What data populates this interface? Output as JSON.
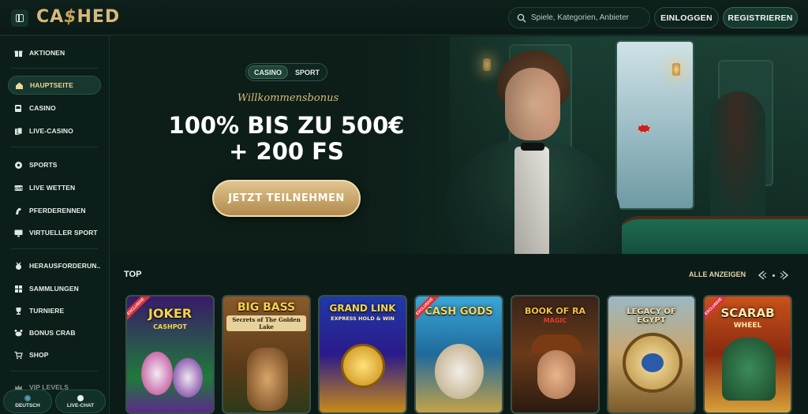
{
  "header": {
    "logo_text": "CASHED",
    "search_placeholder": "Spiele, Kategorien, Anbieter",
    "login_label": "EINLOGGEN",
    "register_label": "REGISTRIEREN"
  },
  "sidebar": {
    "items": [
      {
        "label": "AKTIONEN",
        "icon": "gift-icon"
      },
      {
        "label": "HAUPTSEITE",
        "icon": "home-icon"
      },
      {
        "label": "CASINO",
        "icon": "slot-icon"
      },
      {
        "label": "LIVE-CASINO",
        "icon": "cards-icon"
      },
      {
        "label": "SPORTS",
        "icon": "soccer-icon"
      },
      {
        "label": "LIVE WETTEN",
        "icon": "live-icon"
      },
      {
        "label": "PFERDERENNEN",
        "icon": "horse-icon"
      },
      {
        "label": "VIRTUELLER SPORT",
        "icon": "monitor-icon"
      },
      {
        "label": "HERAUSFORDERUN...",
        "icon": "medal-icon"
      },
      {
        "label": "SAMMLUNGEN",
        "icon": "collection-icon"
      },
      {
        "label": "TURNIERE",
        "icon": "trophy-icon"
      },
      {
        "label": "BONUS CRAB",
        "icon": "crab-icon"
      },
      {
        "label": "SHOP",
        "icon": "cart-icon"
      },
      {
        "label": "VIP LEVELS",
        "icon": "crown-icon"
      }
    ],
    "language_label": "DEUTSCH",
    "chat_label": "LIVE-CHAT"
  },
  "hero": {
    "tab_casino": "CASINO",
    "tab_sport": "SPORT",
    "welcome": "Willkommensbonus",
    "headline_line1": "100% BIS ZU 500€",
    "headline_line2": "+ 200 FS",
    "cta_label": "JETZT TEILNEHMEN"
  },
  "top": {
    "title": "TOP",
    "show_all": "ALLE ANZEIGEN",
    "games": [
      {
        "title": "JOKER",
        "subtitle": "CASHPOT",
        "badge": "EXCLUSIVE"
      },
      {
        "title": "BIG BASS",
        "subtitle": "Secrets of The Golden Lake",
        "badge": ""
      },
      {
        "title": "GRAND LINK",
        "subtitle": "EXPRESS HOLD & WIN",
        "badge": ""
      },
      {
        "title": "CASH GODS",
        "subtitle": "",
        "badge": "EXCLUSIVE"
      },
      {
        "title": "BOOK OF RA",
        "subtitle": "MAGIC",
        "badge": ""
      },
      {
        "title": "LEGACY OF EGYPT",
        "subtitle": "",
        "badge": ""
      },
      {
        "title": "SCARAB",
        "subtitle": "WHEEL",
        "badge": "EXCLUSIVE"
      }
    ]
  },
  "colors": {
    "accent_gold": "#d9bb7c",
    "background": "#0b1c18",
    "badge_red": "#d9323a"
  }
}
